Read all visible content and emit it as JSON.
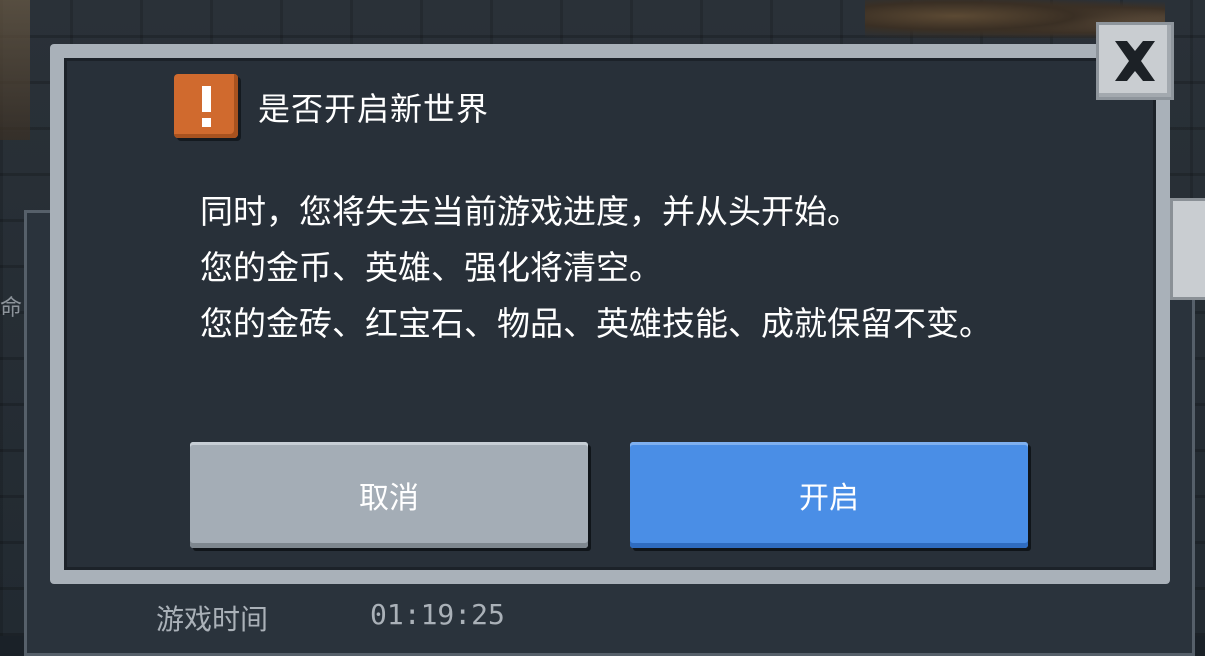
{
  "background": {
    "left_fragment": "命",
    "stats": {
      "play_time_label": "游戏时间",
      "play_time_value": "01:19:25"
    }
  },
  "dialog": {
    "icon": "warning-exclamation-icon",
    "title": "是否开启新世界",
    "body_lines": [
      "同时，您将失去当前游戏进度，并从头开始。",
      "您的金币、英雄、强化将清空。",
      "您的金砖、红宝石、物品、英雄技能、成就保留不变。"
    ],
    "cancel_label": "取消",
    "confirm_label": "开启",
    "close_icon": "close-x-icon"
  },
  "colors": {
    "dialog_bg": "#283039",
    "dialog_border": "#a9b1b9",
    "warning": "#d06a2e",
    "confirm": "#4a8ee6",
    "cancel": "#a4adb6"
  }
}
